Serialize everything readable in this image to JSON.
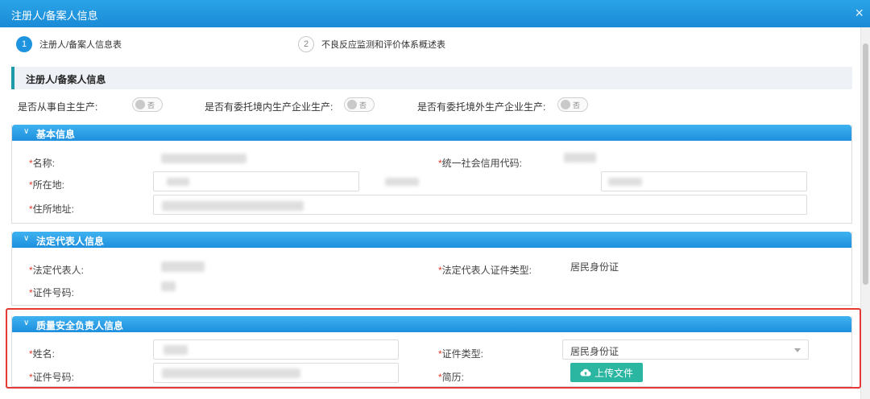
{
  "dialog": {
    "title": "注册人/备案人信息",
    "close": "×"
  },
  "steps": [
    {
      "num": "1",
      "label": "注册人/备案人信息表"
    },
    {
      "num": "2",
      "label": "不良反应监测和评价体系概述表"
    }
  ],
  "section_title": "注册人/备案人信息",
  "questions": [
    {
      "label": "是否从事自主生产:",
      "toggle": "否"
    },
    {
      "label": "是否有委托境内生产企业生产:",
      "toggle": "否"
    },
    {
      "label": "是否有委托境外生产企业生产:",
      "toggle": "否"
    }
  ],
  "basic": {
    "title": "基本信息",
    "name_label": "名称:",
    "credit_code_label": "统一社会信用代码:",
    "location_label": "所在地:",
    "address_label": "住所地址:"
  },
  "legal": {
    "title": "法定代表人信息",
    "rep_label": "法定代表人:",
    "id_type_label": "法定代表人证件类型:",
    "id_type_value": "居民身份证",
    "id_no_label": "证件号码:"
  },
  "quality": {
    "title": "质量安全负责人信息",
    "name_label": "姓名:",
    "id_type_label": "证件类型:",
    "id_type_value": "居民身份证",
    "id_no_label": "证件号码:",
    "resume_label": "简历:",
    "upload_label": "上传文件"
  },
  "required_mark": "*",
  "chevron": "∨",
  "colors": {
    "header_blue": "#1d8fde",
    "accent_teal": "#1e9aa8",
    "upload_green": "#2ab6a0",
    "highlight_red": "#e53935"
  },
  "icons": {
    "close": "close-icon",
    "chevron": "chevron-down-icon",
    "upload": "cloud-upload-icon"
  }
}
